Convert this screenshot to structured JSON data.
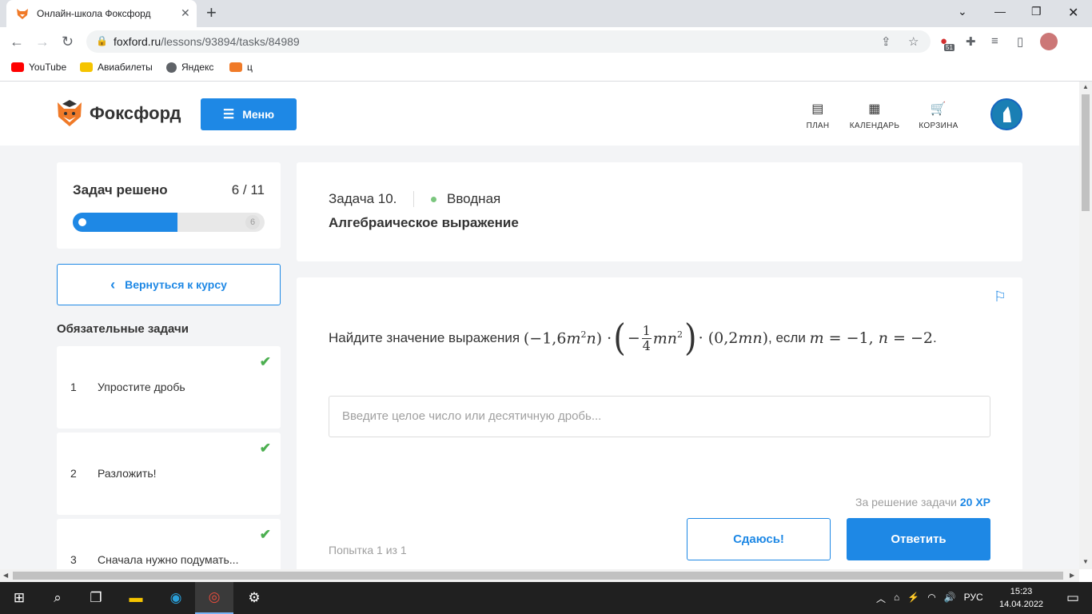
{
  "browser": {
    "tab_title": "Онлайн-школа Фоксфорд",
    "url_host": "foxford.ru",
    "url_path": "/lessons/93894/tasks/84989",
    "ext_badge": "51",
    "bookmarks": [
      "YouTube",
      "Авиабилеты",
      "Яндекс",
      "ц"
    ]
  },
  "header": {
    "logo_text": "Фоксфорд",
    "menu_label": "Меню",
    "nav": [
      "ПЛАН",
      "КАЛЕНДАРЬ",
      "КОРЗИНА"
    ]
  },
  "sidebar": {
    "progress_label": "Задач решено",
    "progress_count": "6 / 11",
    "progress_fraction": 0.545,
    "progress_end": "6",
    "back_label": "Вернуться к курсу",
    "section_title": "Обязательные задачи",
    "tasks": [
      {
        "num": "1",
        "name": "Упростите дробь",
        "done": true
      },
      {
        "num": "2",
        "name": "Разложить!",
        "done": true
      },
      {
        "num": "3",
        "name": "Сначала нужно подумать...",
        "done": true
      }
    ]
  },
  "task": {
    "number": "Задача 10.",
    "level": "Вводная",
    "title": "Алгебраическое выражение",
    "question_prefix": "Найдите значение выражения",
    "question_mid": ", если",
    "answer_placeholder": "Введите целое число или десятичную дробь...",
    "reward_text": "За решение задачи",
    "reward_xp": "20 XP",
    "attempt": "Попытка 1 из 1",
    "giveup_label": "Сдаюсь!",
    "submit_label": "Ответить"
  },
  "taskbar": {
    "lang": "РУС",
    "time": "15:23",
    "date": "14.04.2022"
  },
  "colors": {
    "accent": "#1e88e5",
    "check": "#4caf50",
    "level_dot": "#7bc67e"
  }
}
